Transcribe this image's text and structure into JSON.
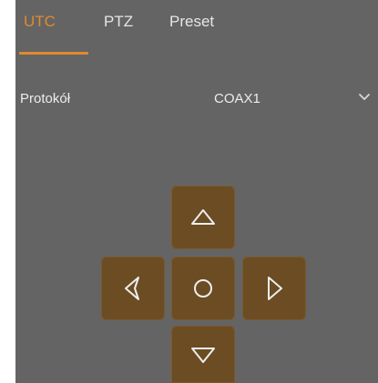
{
  "tabs": [
    {
      "label": "UTC",
      "active": true
    },
    {
      "label": "PTZ",
      "active": false
    },
    {
      "label": "Preset",
      "active": false
    }
  ],
  "protocol": {
    "label": "Protokół",
    "value": "COAX1"
  },
  "dpad": {
    "up_icon": "triangle-up-icon",
    "left_icon": "triangle-left-icon",
    "center_icon": "circle-icon",
    "right_icon": "triangle-right-icon",
    "down_icon": "triangle-down-icon"
  },
  "colors": {
    "panel_bg": "#646464",
    "accent": "#e08a2e",
    "button_bg": "#6b4c23",
    "text": "#ececec"
  }
}
